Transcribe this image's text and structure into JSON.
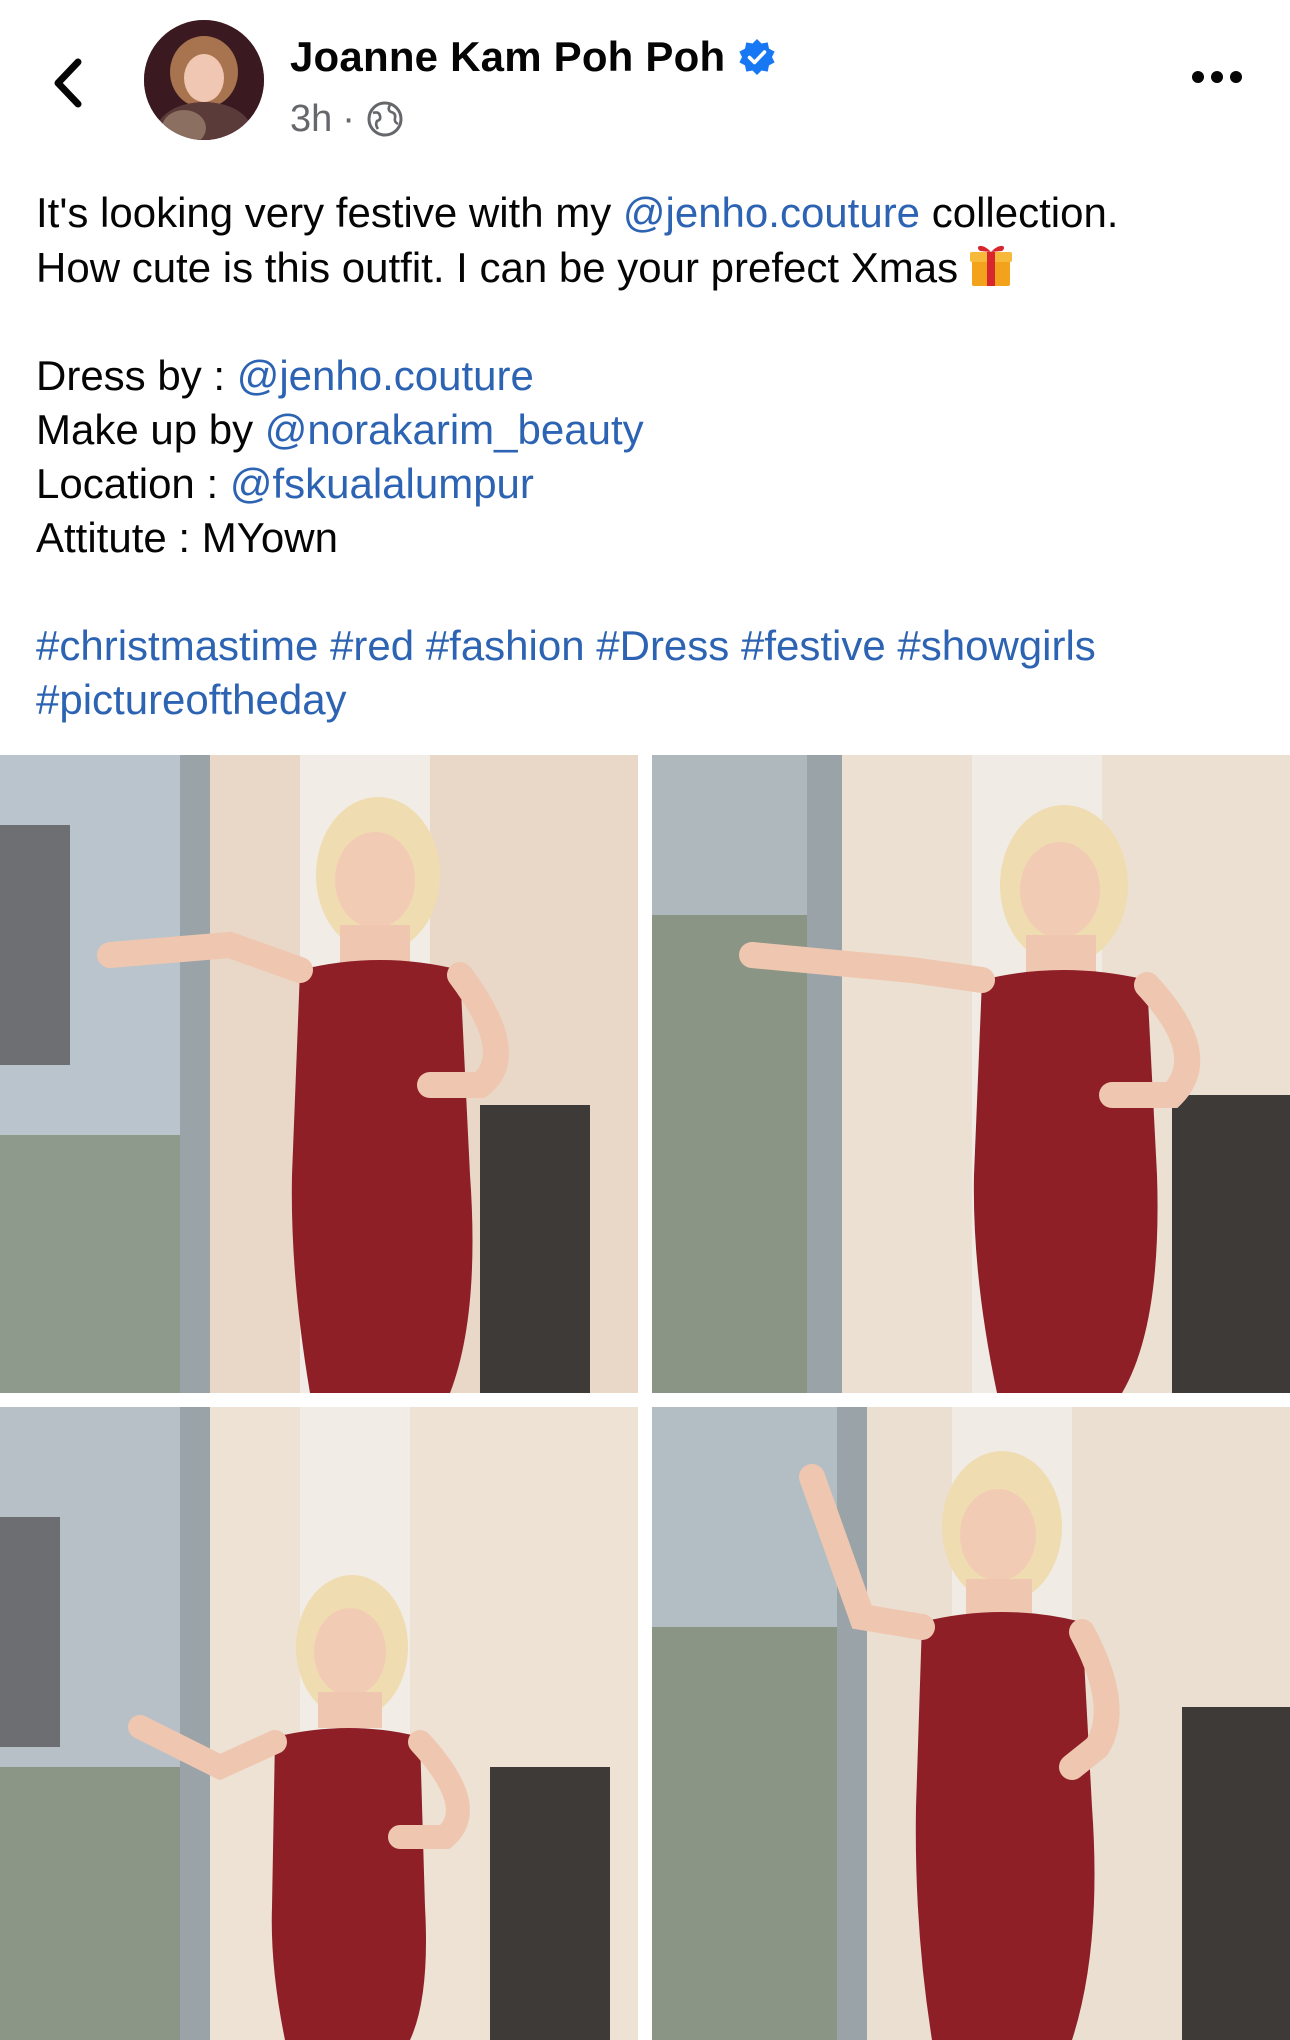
{
  "post": {
    "author": {
      "name": "Joanne Kam Poh Poh",
      "verified": true,
      "time": "3h",
      "separator": "·",
      "audience_icon": "globe-icon"
    },
    "caption": {
      "line1_prefix": "It's looking very festive with my ",
      "line1_mention": "@jenho.couture",
      "line1_suffix": " collection.",
      "line2": "How cute is this outfit. I can be your prefect Xmas",
      "line2_emoji": "gift-icon",
      "credits": [
        {
          "label": "Dress by : ",
          "mention": "@jenho.couture"
        },
        {
          "label": "Make up by ",
          "mention": "@norakarim_beauty"
        },
        {
          "label": "Location : ",
          "mention": "@fskualalumpur"
        }
      ],
      "attitude": "Attitute : MYown",
      "hashtags_line1": "#christmastime #red #fashion #Dress #festive #showgirls",
      "hashtags_line2": "#pictureoftheday"
    },
    "photos": [
      {
        "name": "photo-1"
      },
      {
        "name": "photo-2"
      },
      {
        "name": "photo-3"
      },
      {
        "name": "photo-4"
      }
    ]
  },
  "colors": {
    "link": "#2d63b3",
    "verified": "#1877f2",
    "text": "#050505",
    "meta": "#65676b",
    "dress": "#8e1f27"
  },
  "icons": {
    "back": "chevron-left-icon",
    "more": "more-horizontal-icon",
    "verified": "verified-badge-icon",
    "audience": "globe-icon",
    "emoji": "gift-icon"
  }
}
